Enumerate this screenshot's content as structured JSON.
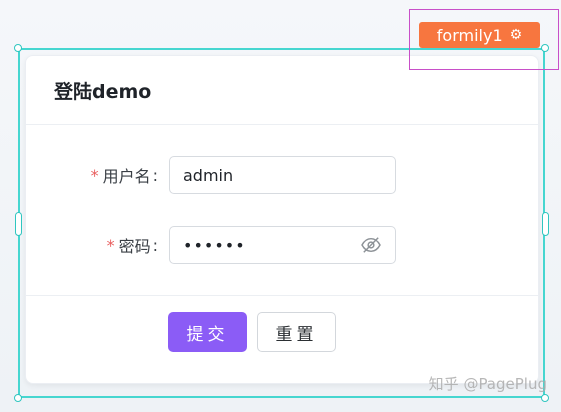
{
  "component_tag": {
    "label": "formily1",
    "icon": "gear-icon",
    "color": "#f7763f"
  },
  "card": {
    "title": "登陆demo"
  },
  "form": {
    "username": {
      "required_mark": "*",
      "label": "用户名",
      "colon": ":",
      "value": "admin"
    },
    "password": {
      "required_mark": "*",
      "label": "密码",
      "colon": ":",
      "value": "••••••",
      "toggle_icon": "eye-off-icon"
    }
  },
  "actions": {
    "submit_label": "提交",
    "reset_label": "重置",
    "primary_color": "#8b5cf6"
  },
  "watermark": "知乎 @PagePlug",
  "colors": {
    "selection": "#46d6d0",
    "hover": "#c84fc8",
    "required": "#e85d5d"
  }
}
